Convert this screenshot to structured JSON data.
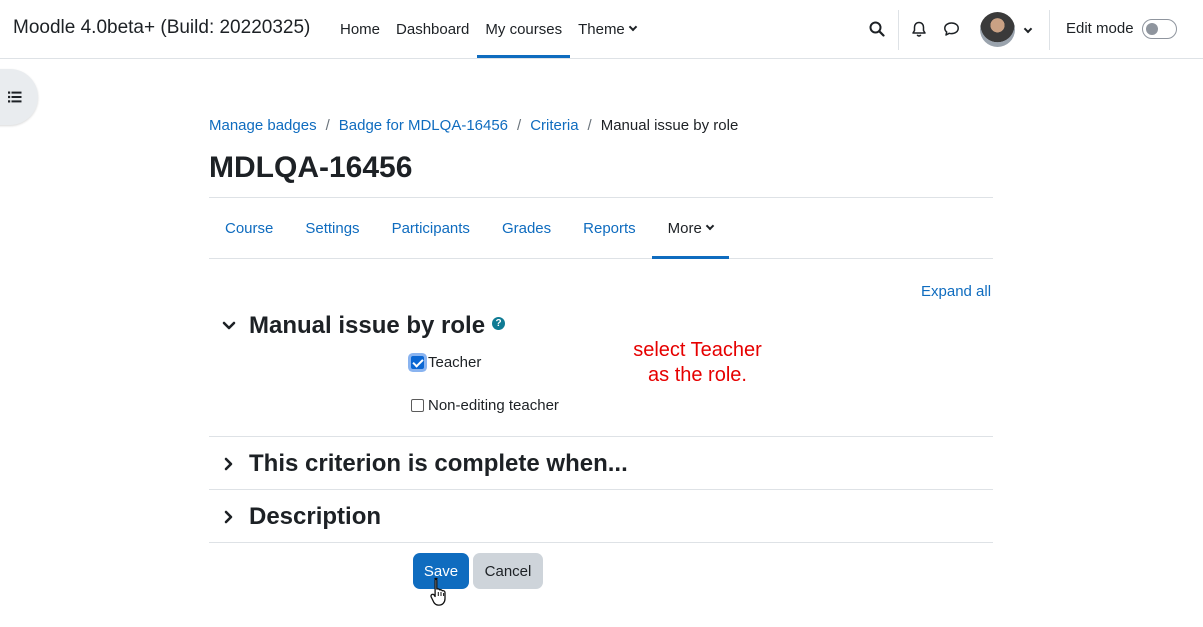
{
  "header": {
    "brand": "Moodle 4.0beta+ (Build: 20220325)",
    "nav": [
      {
        "label": "Home"
      },
      {
        "label": "Dashboard"
      },
      {
        "label": "My courses",
        "active": true
      },
      {
        "label": "Theme",
        "dropdown": true
      }
    ],
    "icons": [
      "search-icon",
      "bell-icon",
      "chat-icon",
      "avatar",
      "chevron-down-icon"
    ],
    "edit_mode_label": "Edit mode",
    "edit_mode_on": false
  },
  "drawer": {
    "icon": "list-icon"
  },
  "breadcrumb": {
    "items": [
      "Manage badges",
      "Badge for MDLQA-16456",
      "Criteria"
    ],
    "current": "Manual issue by role"
  },
  "page_title": "MDLQA-16456",
  "secondary_nav": {
    "tabs": [
      "Course",
      "Settings",
      "Participants",
      "Grades",
      "Reports"
    ],
    "more_label": "More"
  },
  "expand_all": "Expand all",
  "sections": {
    "manual": {
      "title": "Manual issue by role",
      "roles": [
        {
          "label": "Teacher",
          "checked": true
        },
        {
          "label": "Non-editing teacher",
          "checked": false
        }
      ]
    },
    "complete": {
      "title": "This criterion is complete when..."
    },
    "description": {
      "title": "Description"
    }
  },
  "annotation": {
    "line1": "select Teacher",
    "line2": "as the role."
  },
  "buttons": {
    "save": "Save",
    "cancel": "Cancel"
  },
  "colors": {
    "primary": "#0f6cbf",
    "annotation": "#e60000"
  }
}
